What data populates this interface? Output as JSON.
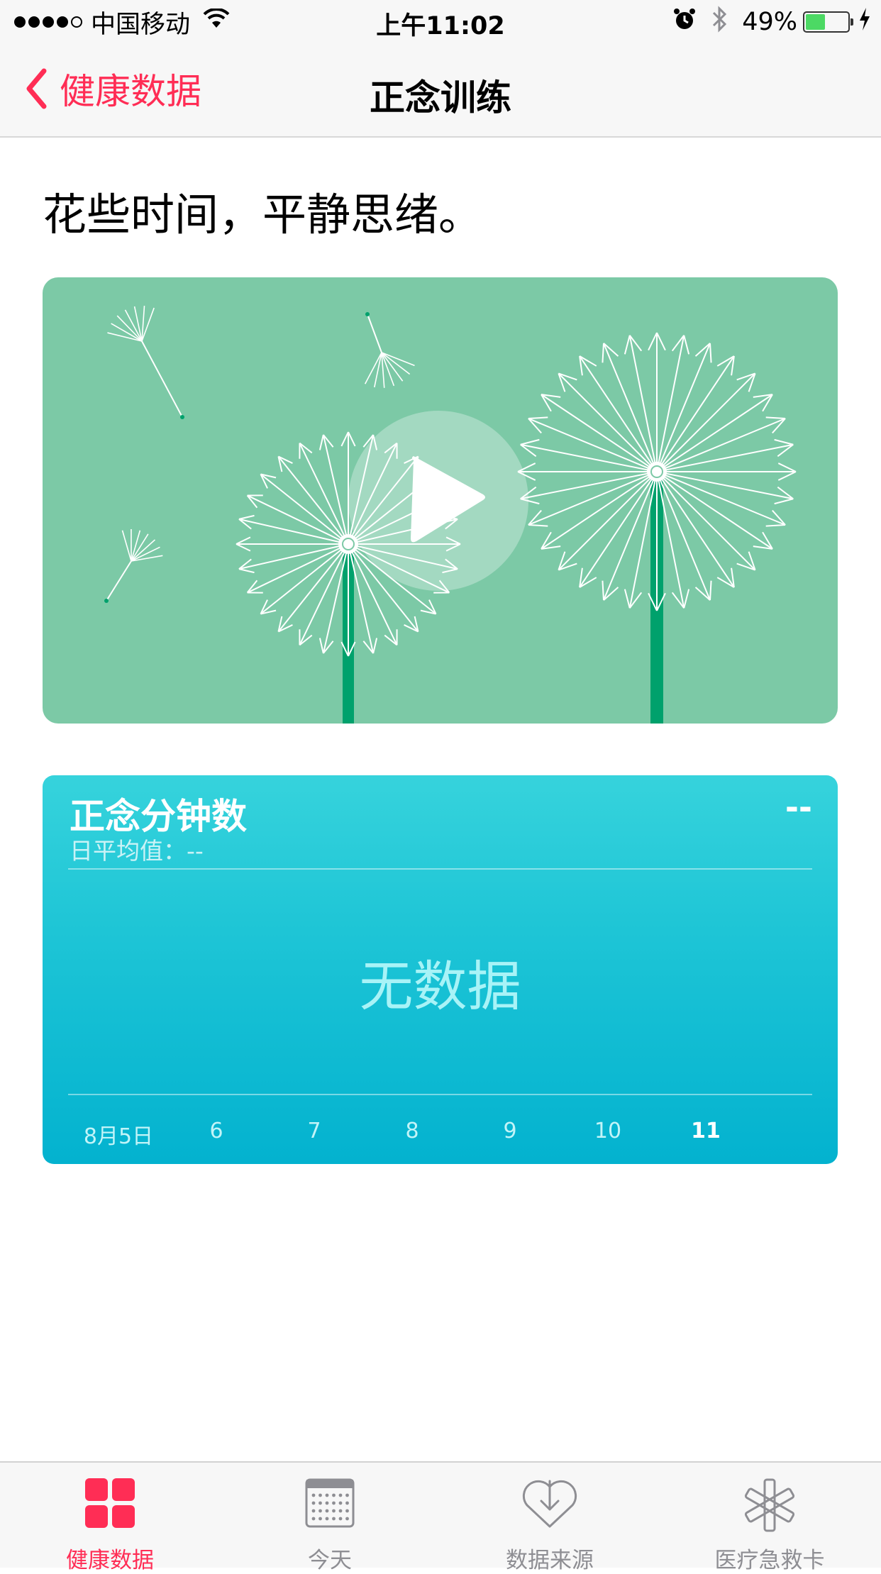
{
  "status_bar": {
    "carrier": "中国移动",
    "time": "上午11:02",
    "battery_percent": "49%",
    "battery_level": 0.49,
    "signal_bars": 4,
    "icons": [
      "wifi-icon",
      "alarm-icon",
      "bluetooth-icon",
      "battery-icon",
      "charging-icon"
    ]
  },
  "nav": {
    "back_label": "健康数据",
    "title": "正念训练"
  },
  "intro_text": "花些时间，平静思绪。",
  "mindful": {
    "title": "正念分钟数",
    "value": "--",
    "daily_avg": "日平均值：--",
    "no_data": "无数据",
    "x_labels": [
      "8月5日",
      "6",
      "7",
      "8",
      "9",
      "10",
      "11"
    ],
    "current_index": 6
  },
  "tabs": [
    {
      "label": "健康数据",
      "icon": "health-data-icon",
      "active": true
    },
    {
      "label": "今天",
      "icon": "calendar-icon",
      "active": false
    },
    {
      "label": "数据来源",
      "icon": "sources-icon",
      "active": false
    },
    {
      "label": "医疗急救卡",
      "icon": "medical-id-icon",
      "active": false
    }
  ],
  "colors": {
    "accent": "#ff2d55",
    "video_bg": "#7cc9a6",
    "stem": "#00a16c",
    "card_top": "#36d3dc",
    "card_bottom": "#03b2cf",
    "battery": "#4cd964"
  }
}
